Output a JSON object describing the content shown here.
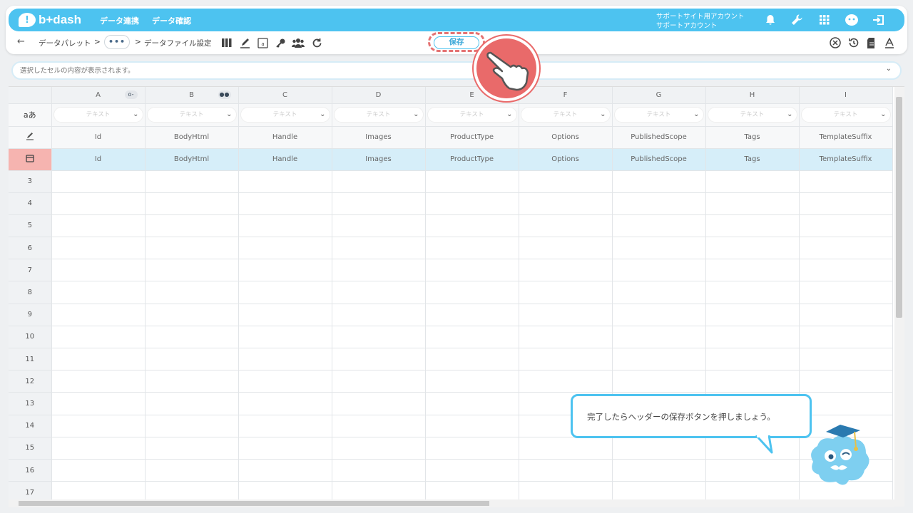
{
  "header": {
    "logo_text": "b+dash",
    "nav": [
      "データ連携",
      "データ確認"
    ],
    "account_line1": "サポートサイト用アカウント",
    "account_line2": "サポートアカウント"
  },
  "breadcrumb": {
    "item1": "データパレット",
    "sep": ">",
    "dots": "•••",
    "current": "データファイル設定"
  },
  "toolbar": {
    "save_label": "保存"
  },
  "content_bar": {
    "placeholder": "選択したセルの内容が表示されます。"
  },
  "grid": {
    "columns": [
      "A",
      "B",
      "C",
      "D",
      "E",
      "F",
      "G",
      "H",
      "I"
    ],
    "type_row_label": "aあ",
    "type_placeholder": "テキスト",
    "fields": [
      "Id",
      "BodyHtml",
      "Handle",
      "Images",
      "ProductType",
      "Options",
      "PublishedScope",
      "Tags",
      "TemplateSuffix"
    ],
    "values": [
      "Id",
      "BodyHtml",
      "Handle",
      "Images",
      "ProductType",
      "Options",
      "PublishedScope",
      "Tags",
      "TemplateSuffix"
    ],
    "row_numbers": [
      "3",
      "4",
      "5",
      "6",
      "7",
      "8",
      "9",
      "10",
      "11",
      "12",
      "13",
      "14",
      "15",
      "16",
      "17"
    ]
  },
  "tutorial": {
    "message": "完了したらヘッダーの保存ボタンを押しましょう。"
  },
  "colors": {
    "brand": "#4dc3f0",
    "highlight": "#e96a6a",
    "selected_row": "#d6eef9"
  }
}
